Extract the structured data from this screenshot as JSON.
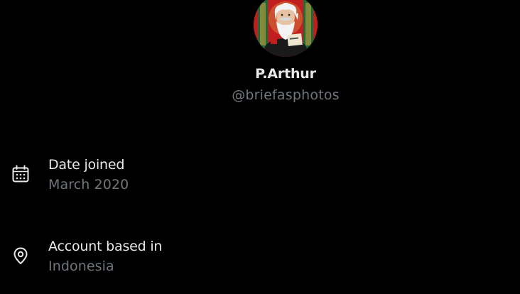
{
  "profile": {
    "display_name": "P.Arthur",
    "handle": "@briefasphotos"
  },
  "about": {
    "rows": [
      {
        "icon": "calendar-icon",
        "label": "Date joined",
        "value": "March 2020"
      },
      {
        "icon": "location-pin-icon",
        "label": "Account based in",
        "value": "Indonesia"
      }
    ]
  },
  "colors": {
    "background": "#000000",
    "primary_text": "#e7e9ea",
    "secondary_text": "#71767b"
  }
}
